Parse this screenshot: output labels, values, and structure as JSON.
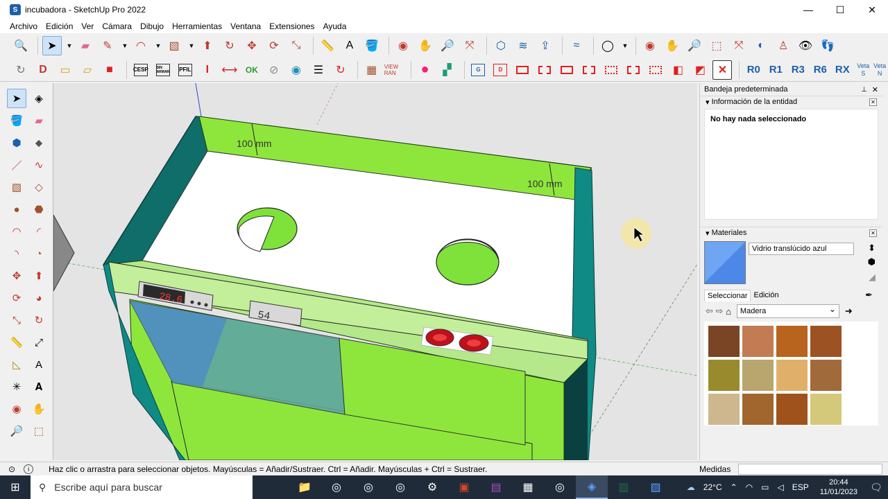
{
  "window": {
    "title": "incubadora - SketchUp Pro 2022",
    "app_icon": "sketchup-icon",
    "minimize": "—",
    "maximize": "☐",
    "close": "✕"
  },
  "menu": [
    "Archivo",
    "Edición",
    "Ver",
    "Cámara",
    "Dibujo",
    "Herramientas",
    "Ventana",
    "Extensiones",
    "Ayuda"
  ],
  "toolbar2": {
    "tool_labels": [
      "CESP",
      "SIN ARMAR",
      "PFIL",
      "I",
      "OK"
    ],
    "rotations": [
      "R0",
      "R1",
      "R3",
      "R6",
      "RX"
    ],
    "veta_s": "Veta S",
    "veta_n": "Veta N",
    "tool_icons": [
      "G",
      "D"
    ]
  },
  "model": {
    "dimension_1": "100 mm",
    "dimension_2": "100 mm",
    "temp_display": "28.6",
    "humidity_display": "54"
  },
  "tray": {
    "title": "Bandeja predeterminada",
    "entity_panel": {
      "heading": "Información de la entidad",
      "message": "No hay nada seleccionado"
    },
    "materials_panel": {
      "heading": "Materiales",
      "current_material": "Vidrio translúcido azul",
      "tab_select": "Seleccionar",
      "tab_edit": "Edición",
      "library": "Madera",
      "swatch_colors": [
        "#7a4524",
        "#c27b52",
        "#b8631e",
        "#9c5222",
        "#9a8a2e",
        "#b9a66e",
        "#e0b06a",
        "#a16a3a",
        "#ceb78e",
        "#a0662e",
        "#a0521c",
        "#d4c87a"
      ]
    }
  },
  "statusbar": {
    "message": "Haz clic o arrastra para seleccionar objetos. Mayúsculas = Añadir/Sustraer. Ctrl = Añadir. Mayúsculas + Ctrl = Sustraer.",
    "measurements_label": "Medidas",
    "measurements_value": ""
  },
  "taskbar": {
    "search_placeholder": "Escribe aquí para buscar",
    "weather": "22°C",
    "language": "ESP",
    "time": "20:44",
    "date": "11/01/2023"
  }
}
